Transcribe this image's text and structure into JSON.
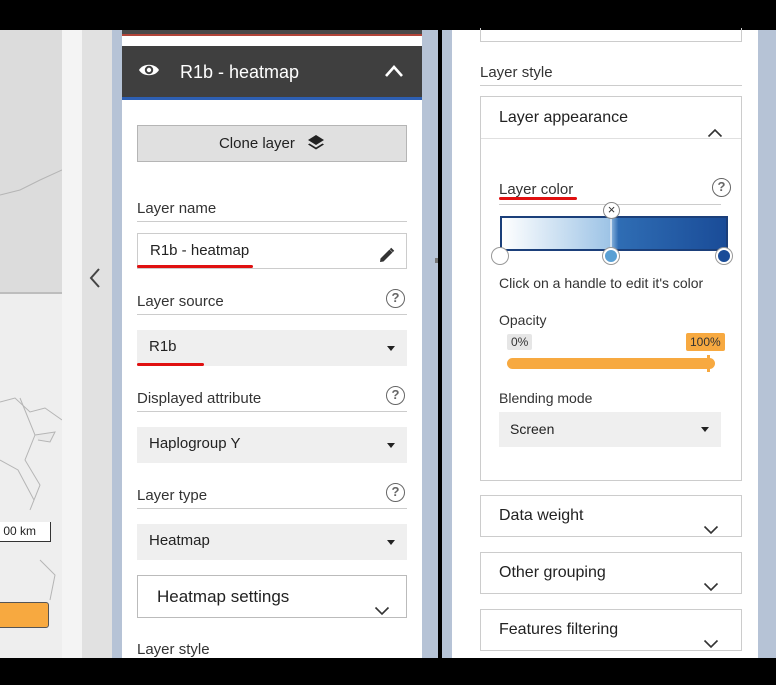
{
  "map": {
    "scale_label": "00 km",
    "legend_color": "#f7a940"
  },
  "collapse_icon": "chevron-left-icon",
  "left_panel": {
    "layer_title": "R1b - heatmap",
    "visibility_icon": "eye-icon",
    "collapse_icon": "chevron-up-icon",
    "clone_button": "Clone layer",
    "clone_icon": "layers-icon",
    "layer_name": {
      "label": "Layer name",
      "value": "R1b - heatmap",
      "icon": "pencil-icon"
    },
    "layer_source": {
      "label": "Layer source",
      "value": "R1b"
    },
    "displayed_attribute": {
      "label": "Displayed attribute",
      "value": "Haplogroup Y"
    },
    "layer_type": {
      "label": "Layer type",
      "value": "Heatmap"
    },
    "help_glyph": "?",
    "heatmap_settings": "Heatmap settings",
    "layer_style": "Layer style"
  },
  "right_panel": {
    "layer_style": "Layer style",
    "appearance": {
      "title": "Layer appearance",
      "layer_color_label": "Layer color",
      "help_glyph": "?",
      "gradient_colors": [
        "#ffffff",
        "#5aa0d4",
        "#1a4c98"
      ],
      "remove_handle_glyph": "×",
      "hint": "Click on a handle to edit it's color",
      "opacity_label": "Opacity",
      "opacity_min": "0%",
      "opacity_max": "100%",
      "opacity_value": 100,
      "blending_label": "Blending mode",
      "blending_value": "Screen"
    },
    "sections": [
      "Data weight",
      "Other grouping",
      "Features filtering"
    ]
  },
  "accent_colors": {
    "orange": "#f7a940",
    "blue": "#2d5fb3",
    "annotation_red": "#e01010"
  }
}
